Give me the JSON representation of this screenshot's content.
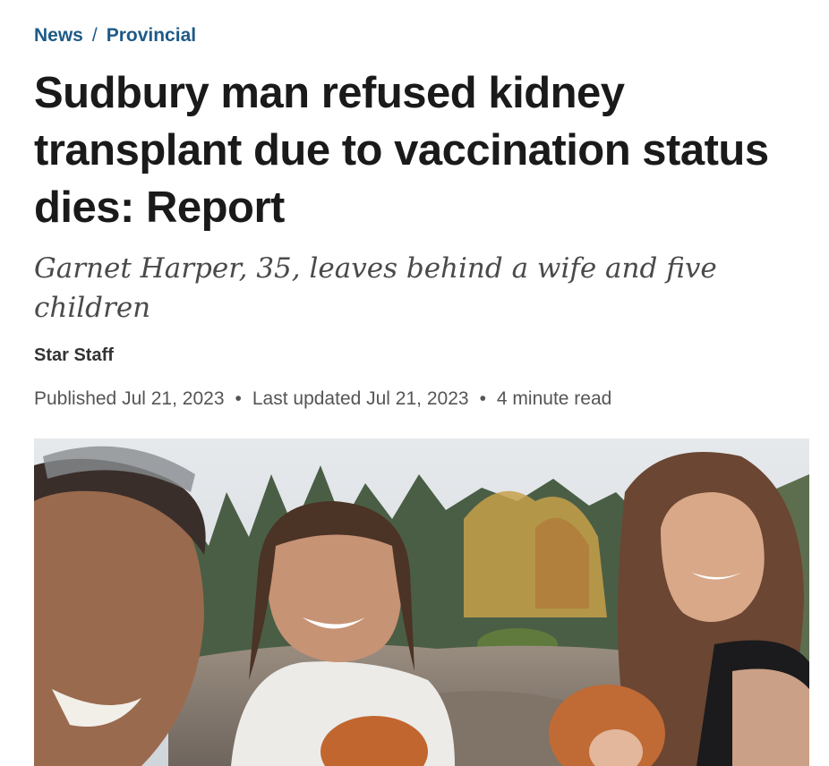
{
  "breadcrumb": {
    "section": "News",
    "separator": "/",
    "subsection": "Provincial"
  },
  "article": {
    "headline": "Sudbury man refused kidney transplant due to vaccination status dies: Report",
    "deck": "Garnet Harper, 35, leaves behind a wife and five children",
    "byline": "Star Staff",
    "published": "Published Jul 21, 2023",
    "updated": "Last updated Jul 21, 2023",
    "read_time": "4 minute read",
    "meta_separator": "•"
  },
  "photo": {
    "subject": "family-photo"
  },
  "colors": {
    "link": "#1e5a87",
    "headline": "#1a1a1a",
    "deck": "#4a4a4a",
    "meta": "#555555"
  }
}
